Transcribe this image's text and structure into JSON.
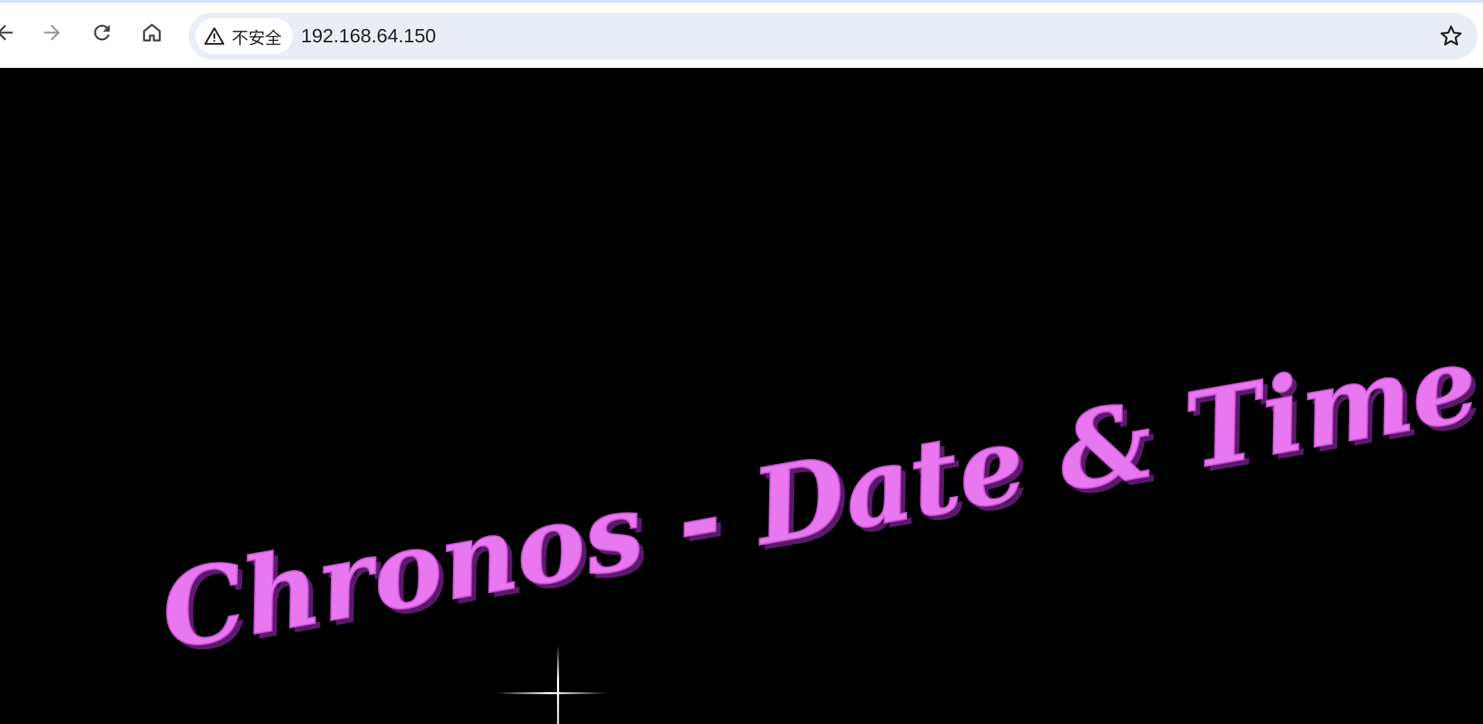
{
  "browser": {
    "security_label": "不安全",
    "url": "192.168.64.150",
    "buttons": {
      "back": "back-icon",
      "forward": "forward-icon",
      "reload": "reload-icon",
      "home": "home-icon",
      "bookmark": "star-icon"
    }
  },
  "page": {
    "title": "Chronos - Date & Time",
    "title_color": "#e877f0",
    "background": "#000000"
  }
}
